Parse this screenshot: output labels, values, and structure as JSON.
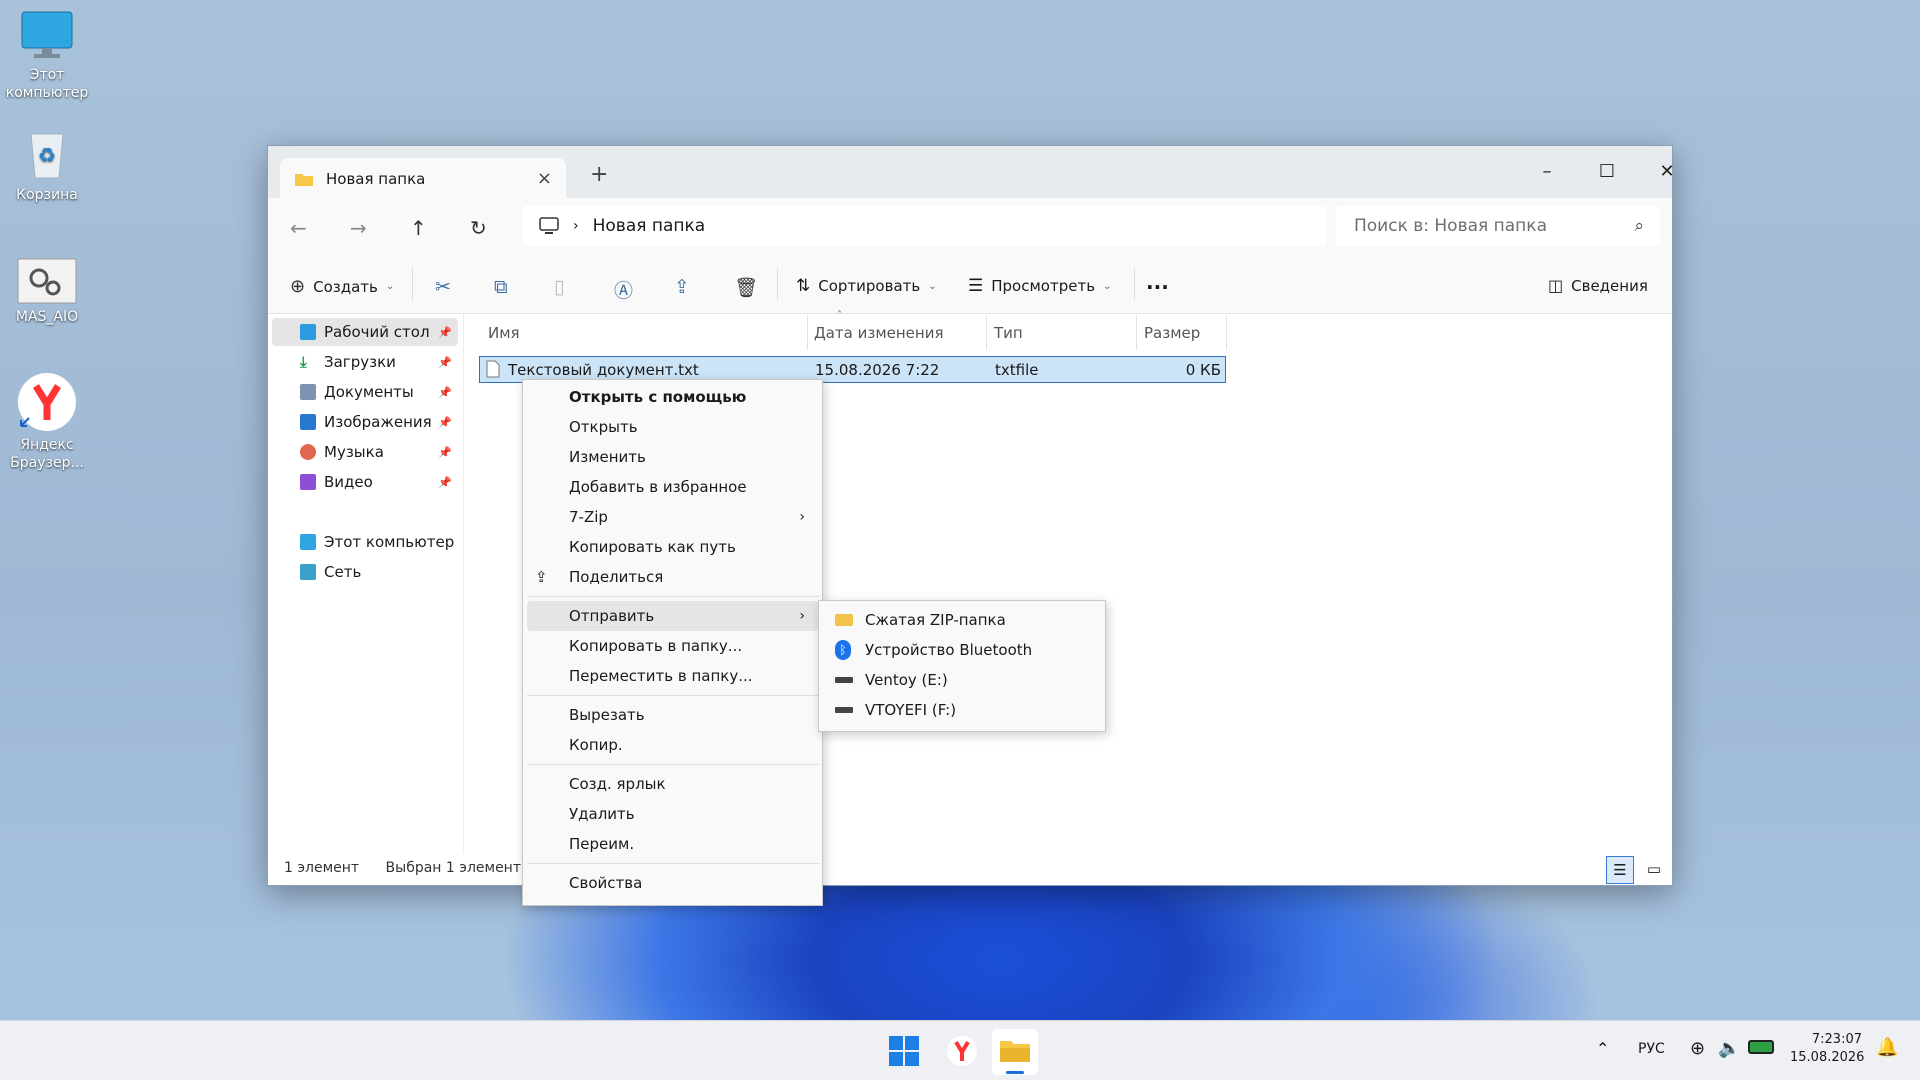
{
  "desktop": {
    "icons": [
      {
        "label": "Этот компьютер"
      },
      {
        "label": "Корзина"
      },
      {
        "label": "MAS_AIO"
      },
      {
        "label": "Яндекс Браузер..."
      }
    ]
  },
  "explorer": {
    "tab_title": "Новая папка",
    "breadcrumb": "Новая папка",
    "search_placeholder": "Поиск в: Новая папка",
    "toolbar": {
      "create": "Создать",
      "sort": "Сортировать",
      "view": "Просмотреть",
      "more": "...",
      "details": "Сведения"
    },
    "sidebar": {
      "items": [
        {
          "label": "Рабочий стол"
        },
        {
          "label": "Загрузки"
        },
        {
          "label": "Документы"
        },
        {
          "label": "Изображения"
        },
        {
          "label": "Музыка"
        },
        {
          "label": "Видео"
        },
        {
          "label": "Этот компьютер"
        },
        {
          "label": "Сеть"
        }
      ]
    },
    "columns": {
      "name": "Имя",
      "date": "Дата изменения",
      "type": "Тип",
      "size": "Размер"
    },
    "file": {
      "name": "Текстовый документ.txt",
      "date": "15.08.2026 7:22",
      "type": "txtfile",
      "size": "0 КБ"
    },
    "status": {
      "count": "1 элемент",
      "selected": "Выбран 1 элемент: 0"
    }
  },
  "context_menu": {
    "items": [
      "Открыть с помощью",
      "Открыть",
      "Изменить",
      "Добавить в избранное",
      "7-Zip",
      "Копировать как путь",
      "Поделиться",
      "Отправить",
      "Копировать в папку...",
      "Переместить в папку...",
      "Вырезать",
      "Копир.",
      "Созд. ярлык",
      "Удалить",
      "Переим.",
      "Свойства"
    ]
  },
  "send_to_menu": {
    "items": [
      "Сжатая ZIP-папка",
      "Устройство Bluetooth",
      "Ventoy (E:)",
      "VTOYEFI (F:)"
    ]
  },
  "taskbar": {
    "lang": "РУС",
    "time": "7:23:07",
    "date": "15.08.2026"
  }
}
